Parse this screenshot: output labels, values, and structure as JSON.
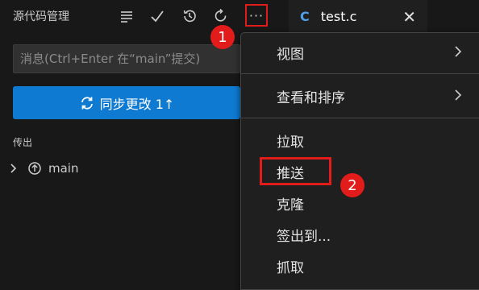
{
  "scm": {
    "title": "源代码管理",
    "toolbar": {
      "icons": [
        "view-as-list-icon",
        "commit-check-icon",
        "history-icon",
        "refresh-icon",
        "more-actions-icon"
      ],
      "more_label": "···"
    },
    "commit_input": {
      "placeholder": "消息(Ctrl+Enter 在“main”提交)"
    },
    "sync_button": {
      "label": "同步更改 1↑"
    },
    "outgoing": {
      "header": "传出",
      "branch": "main"
    }
  },
  "editor": {
    "tab": {
      "lang_icon": "C",
      "label": "test.c",
      "close": "✕"
    }
  },
  "menu": {
    "items": [
      {
        "label": "视图",
        "submenu": true
      },
      {
        "label": "查看和排序",
        "submenu": true
      },
      {
        "label": "拉取",
        "submenu": false
      },
      {
        "label": "推送",
        "submenu": false
      },
      {
        "label": "克隆",
        "submenu": false
      },
      {
        "label": "签出到...",
        "submenu": false
      },
      {
        "label": "抓取",
        "submenu": false
      }
    ]
  },
  "annotations": {
    "badge_1": "1",
    "badge_2": "2",
    "color": "#e21b1b"
  },
  "colors": {
    "sidebar_bg": "#181818",
    "editor_bg": "#1f1f1f",
    "accent_button": "#0e7ad1"
  }
}
